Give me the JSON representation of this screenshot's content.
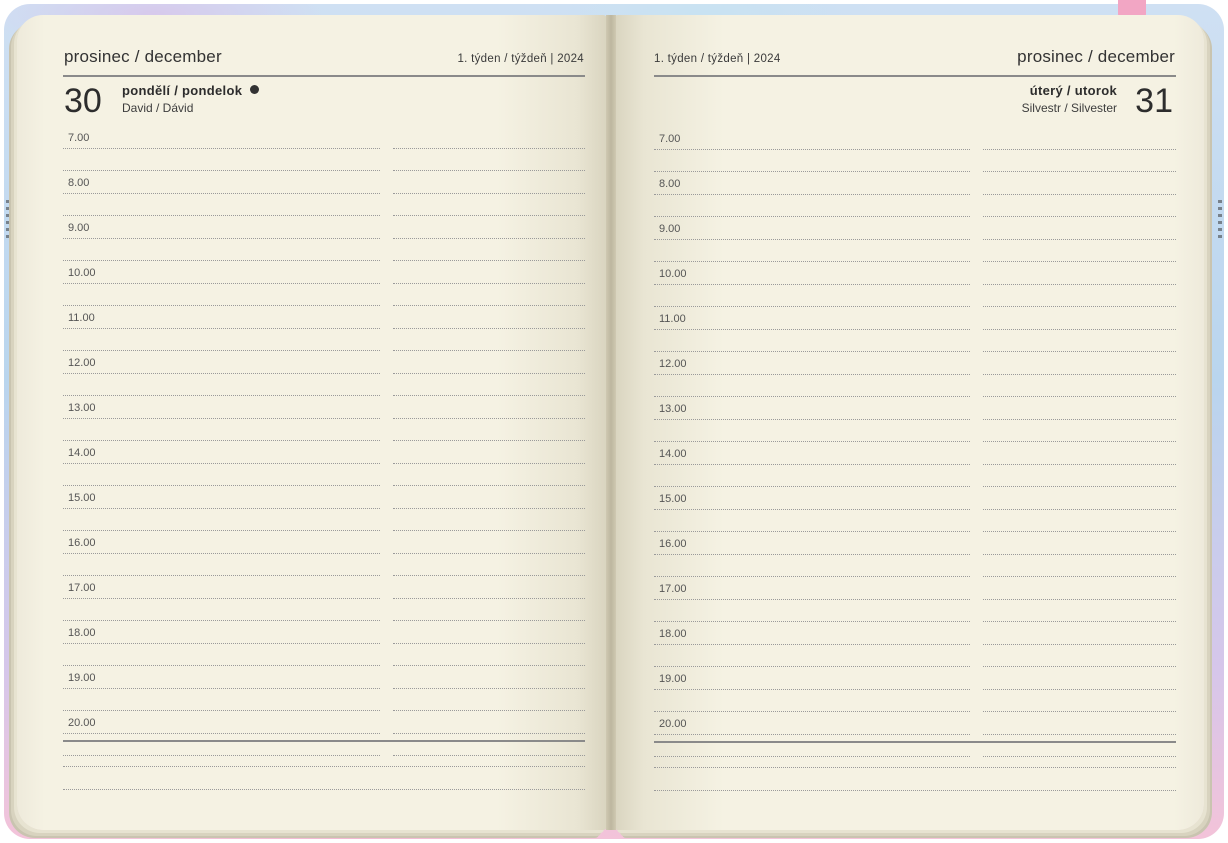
{
  "left_page": {
    "month": "prosinec / december",
    "week": "1. týden / týždeň | 2024",
    "day_number": "30",
    "day_name": "pondělí / pondelok",
    "name_day": "David / Dávid"
  },
  "right_page": {
    "month": "prosinec / december",
    "week": "1. týden / týždeň | 2024",
    "day_number": "31",
    "day_name": "úterý / utorok",
    "name_day": "Silvestr / Silvester"
  },
  "hours": [
    "7.00",
    "8.00",
    "9.00",
    "10.00",
    "11.00",
    "12.00",
    "13.00",
    "14.00",
    "15.00",
    "16.00",
    "17.00",
    "18.00",
    "19.00",
    "20.00"
  ],
  "colors": {
    "paper": "#f5f2e3",
    "ink": "#333333",
    "cover_blue": "#b9d5ee",
    "cover_pink": "#f3c3d9",
    "bookmark": "#f2a6c4"
  }
}
